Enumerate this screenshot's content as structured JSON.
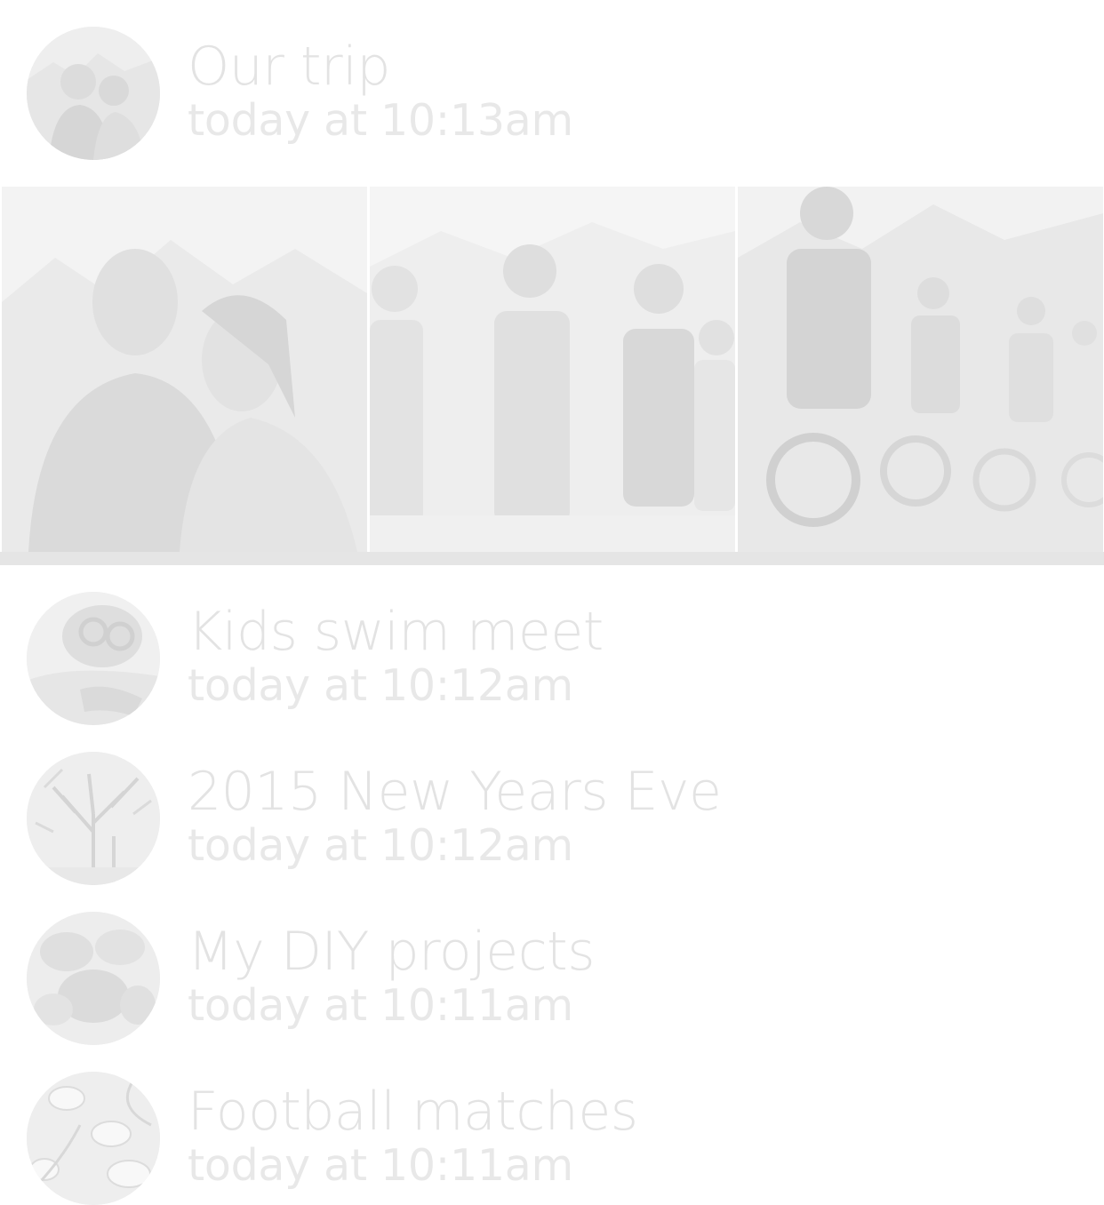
{
  "albums": [
    {
      "title": "Our trip",
      "timestamp": "today at 10:13am",
      "avatar_icon": "couple-photo-thumbnail",
      "photos": [
        {
          "icon": "couple-hug-photo"
        },
        {
          "icon": "family-hiking-photo"
        },
        {
          "icon": "mountain-biking-photo"
        }
      ]
    },
    {
      "title": "Kids swim meet",
      "timestamp": "today at 10:12am",
      "avatar_icon": "swimmer-photo-thumbnail"
    },
    {
      "title": "2015 New Years Eve",
      "timestamp": "today at 10:12am",
      "avatar_icon": "winter-tree-photo-thumbnail"
    },
    {
      "title": "My DIY projects",
      "timestamp": "today at 10:11am",
      "avatar_icon": "diy-project-photo-thumbnail"
    },
    {
      "title": "Football matches",
      "timestamp": "today at 10:11am",
      "avatar_icon": "sheep-photo-thumbnail"
    }
  ],
  "colors": {
    "background": "#ffffff",
    "title_text": "#e3e3e3",
    "subtitle_text": "#e8e8e8",
    "divider": "#e5e5e5"
  }
}
